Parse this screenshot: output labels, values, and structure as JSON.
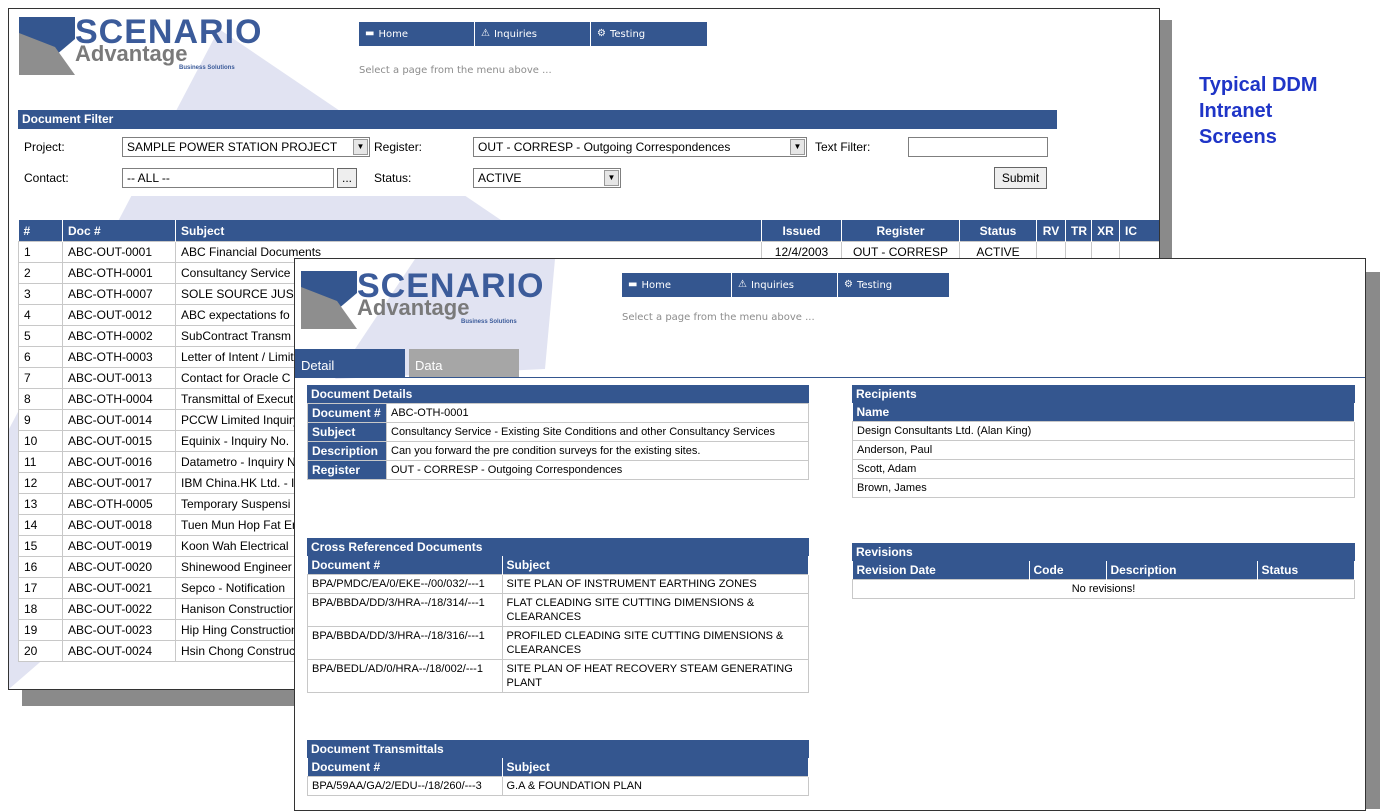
{
  "caption": {
    "line1": "Typical DDM",
    "line2": "Intranet",
    "line3": "Screens"
  },
  "brand": {
    "name_line1": "SCENARIO",
    "name_line2": "Advantage",
    "tagline": "Business Solutions"
  },
  "menu": {
    "home": "Home",
    "inquiries": "Inquiries",
    "testing": "Testing"
  },
  "menu_hint": "Select a page from the menu above ...",
  "filter": {
    "title": "Document Filter",
    "project_label": "Project:",
    "project_value": "SAMPLE POWER STATION PROJECT",
    "register_label": "Register:",
    "register_value": "OUT - CORRESP - Outgoing Correspondences",
    "text_filter_label": "Text Filter:",
    "text_filter_value": "",
    "contact_label": "Contact:",
    "contact_value": "-- ALL --",
    "browse_label": "...",
    "status_label": "Status:",
    "status_value": "ACTIVE",
    "submit_label": "Submit"
  },
  "doc_list": {
    "columns": [
      "#",
      "Doc #",
      "Subject",
      "Issued",
      "Register",
      "Status",
      "RV",
      "TR",
      "XR",
      "IC"
    ],
    "rows": [
      [
        "1",
        "ABC-OUT-0001",
        "ABC Financial Documents",
        "12/4/2003",
        "OUT - CORRESP",
        "ACTIVE"
      ],
      [
        "2",
        "ABC-OTH-0001",
        "Consultancy Service",
        "",
        "",
        ""
      ],
      [
        "3",
        "ABC-OTH-0007",
        "SOLE SOURCE JUST",
        "",
        "",
        ""
      ],
      [
        "4",
        "ABC-OUT-0012",
        "ABC expectations fo",
        "",
        "",
        ""
      ],
      [
        "5",
        "ABC-OTH-0002",
        "SubContract Transm",
        "",
        "",
        ""
      ],
      [
        "6",
        "ABC-OTH-0003",
        "Letter of Intent / Limit",
        "",
        "",
        ""
      ],
      [
        "7",
        "ABC-OUT-0013",
        "Contact for Oracle C",
        "",
        "",
        ""
      ],
      [
        "8",
        "ABC-OTH-0004",
        "Transmittal of Execut",
        "",
        "",
        ""
      ],
      [
        "9",
        "ABC-OUT-0014",
        "PCCW Limited Inquiry",
        "",
        "",
        ""
      ],
      [
        "10",
        "ABC-OUT-0015",
        "Equinix - Inquiry No.",
        "",
        "",
        ""
      ],
      [
        "11",
        "ABC-OUT-0016",
        "Datametro - Inquiry N",
        "",
        "",
        ""
      ],
      [
        "12",
        "ABC-OUT-0017",
        "IBM China.HK Ltd. - I",
        "",
        "",
        ""
      ],
      [
        "13",
        "ABC-OTH-0005",
        "Temporary Suspensi",
        "",
        "",
        ""
      ],
      [
        "14",
        "ABC-OUT-0018",
        "Tuen Mun Hop Fat Er",
        "",
        "",
        ""
      ],
      [
        "15",
        "ABC-OUT-0019",
        "Koon Wah Electrical",
        "",
        "",
        ""
      ],
      [
        "16",
        "ABC-OUT-0020",
        "Shinewood Engineer",
        "",
        "",
        ""
      ],
      [
        "17",
        "ABC-OUT-0021",
        "Sepco - Notification",
        "",
        "",
        ""
      ],
      [
        "18",
        "ABC-OUT-0022",
        "Hanison Constructior",
        "",
        "",
        ""
      ],
      [
        "19",
        "ABC-OUT-0023",
        "Hip Hing Construction",
        "",
        "",
        ""
      ],
      [
        "20",
        "ABC-OUT-0024",
        "Hsin Chong Construc",
        "",
        "",
        ""
      ]
    ]
  },
  "detail_tabs": {
    "detail": "Detail",
    "data": "Data"
  },
  "document_details": {
    "title": "Document Details",
    "rows": [
      [
        "Document #",
        "ABC-OTH-0001"
      ],
      [
        "Subject",
        "Consultancy Service - Existing Site Conditions and other Consultancy Services"
      ],
      [
        "Description",
        "Can you forward the pre condition surveys for the existing sites."
      ],
      [
        "Register",
        "OUT - CORRESP - Outgoing Correspondences"
      ]
    ]
  },
  "recipients": {
    "title": "Recipients",
    "header": "Name",
    "rows": [
      "Design Consultants Ltd. (Alan King)",
      "Anderson, Paul",
      "Scott, Adam",
      "Brown, James"
    ]
  },
  "revisions": {
    "title": "Revisions",
    "columns": [
      "Revision Date",
      "Code",
      "Description",
      "Status"
    ],
    "empty": "No revisions!"
  },
  "cross_ref": {
    "title": "Cross Referenced Documents",
    "columns": [
      "Document #",
      "Subject"
    ],
    "rows": [
      [
        "BPA/PMDC/EA/0/EKE--/00/032/---1",
        "SITE PLAN OF INSTRUMENT EARTHING ZONES"
      ],
      [
        "BPA/BBDA/DD/3/HRA--/18/314/---1",
        "FLAT CLEADING SITE CUTTING DIMENSIONS & CLEARANCES"
      ],
      [
        "BPA/BBDA/DD/3/HRA--/18/316/---1",
        "PROFILED CLEADING SITE CUTTING DIMENSIONS & CLEARANCES"
      ],
      [
        "BPA/BEDL/AD/0/HRA--/18/002/---1",
        "SITE PLAN OF HEAT RECOVERY STEAM GENERATING PLANT"
      ]
    ]
  },
  "transmittals": {
    "title": "Document Transmittals",
    "columns": [
      "Document #",
      "Subject"
    ],
    "rows": [
      [
        "BPA/59AA/GA/2/EDU--/18/260/---3",
        "G.A & FOUNDATION PLAN"
      ]
    ]
  },
  "colors": {
    "header_blue": "#34568f",
    "caption_blue": "#1f35c7",
    "tab_inactive": "#a6a6a6"
  }
}
